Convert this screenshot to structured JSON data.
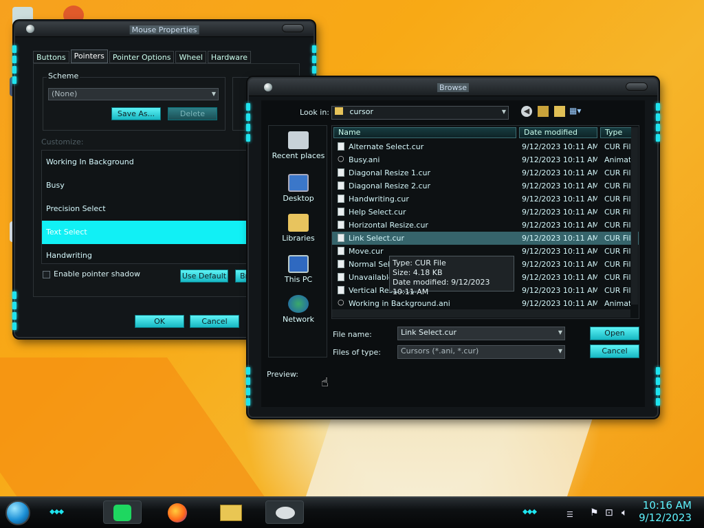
{
  "mouse_properties": {
    "title": "Mouse Properties",
    "tabs": [
      "Buttons",
      "Pointers",
      "Pointer Options",
      "Wheel",
      "Hardware"
    ],
    "active_tab": "Pointers",
    "scheme_label": "Scheme",
    "scheme_value": "(None)",
    "save_as": "Save As...",
    "delete": "Delete",
    "customize_label": "Customize:",
    "pointers": [
      "Working In Background",
      "Busy",
      "Precision Select",
      "Text Select",
      "Handwriting"
    ],
    "selected_pointer": "Text Select",
    "shadow_label": "Enable pointer shadow",
    "use_default": "Use Default",
    "browse_partial": "Br",
    "ok": "OK",
    "cancel": "Cancel"
  },
  "browse": {
    "title": "Browse",
    "look_in_label": "Look in:",
    "look_in_value": "cursor",
    "places": [
      "Recent places",
      "Desktop",
      "Libraries",
      "This PC",
      "Network"
    ],
    "columns": [
      "Name",
      "Date modified",
      "Type"
    ],
    "files": [
      {
        "name": "Alternate Select.cur",
        "date": "9/12/2023 10:11 AM",
        "type": "CUR File",
        "icon": "file-icon"
      },
      {
        "name": "Busy.ani",
        "date": "9/12/2023 10:11 AM",
        "type": "Animated",
        "icon": "busy-ring-icon"
      },
      {
        "name": "Diagonal Resize 1.cur",
        "date": "9/12/2023 10:11 AM",
        "type": "CUR File",
        "icon": "file-icon"
      },
      {
        "name": "Diagonal Resize 2.cur",
        "date": "9/12/2023 10:11 AM",
        "type": "CUR File",
        "icon": "file-icon"
      },
      {
        "name": "Handwriting.cur",
        "date": "9/12/2023 10:11 AM",
        "type": "CUR File",
        "icon": "file-icon"
      },
      {
        "name": "Help Select.cur",
        "date": "9/12/2023 10:11 AM",
        "type": "CUR File",
        "icon": "file-icon"
      },
      {
        "name": "Horizontal Resize.cur",
        "date": "9/12/2023 10:11 AM",
        "type": "CUR File",
        "icon": "file-icon"
      },
      {
        "name": "Link Select.cur",
        "date": "9/12/2023 10:11 AM",
        "type": "CUR File",
        "icon": "file-icon"
      },
      {
        "name": "Move.cur",
        "date": "9/12/2023 10:11 AM",
        "type": "CUR File",
        "icon": "file-icon"
      },
      {
        "name": "Normal Select.cur",
        "date": "9/12/2023 10:11 AM",
        "type": "CUR File",
        "icon": "file-icon"
      },
      {
        "name": "Unavailable.cur",
        "date": "9/12/2023 10:11 AM",
        "type": "CUR File",
        "icon": "file-icon"
      },
      {
        "name": "Vertical Resize.cur",
        "date": "9/12/2023 10:11 AM",
        "type": "CUR File",
        "icon": "file-icon"
      },
      {
        "name": "Working in Background.ani",
        "date": "9/12/2023 10:11 AM",
        "type": "Animated",
        "icon": "busy-ring-icon"
      }
    ],
    "selected_file": "Link Select.cur",
    "tooltip": {
      "type": "Type: CUR File",
      "size": "Size: 4.18 KB",
      "date": "Date modified: 9/12/2023 10:11 AM"
    },
    "file_name_label": "File name:",
    "file_name_value": "Link Select.cur",
    "files_of_type_label": "Files of type:",
    "files_of_type_value": "Cursors (*.ani, *.cur)",
    "open": "Open",
    "cancel": "Cancel",
    "preview_label": "Preview:"
  },
  "taskbar": {
    "apps": [
      "spotify-icon",
      "firefox-icon",
      "file-explorer-icon",
      "mouse-properties-icon"
    ],
    "tray_icons": [
      "flag-icon",
      "network-icon",
      "volume-icon"
    ],
    "time": "10:16 AM",
    "date": "9/12/2023"
  },
  "colors": {
    "accent": "#1fe3ee",
    "selection": "#11f0f5",
    "window_bg": "#121619",
    "clock": "#5ff4ff"
  }
}
